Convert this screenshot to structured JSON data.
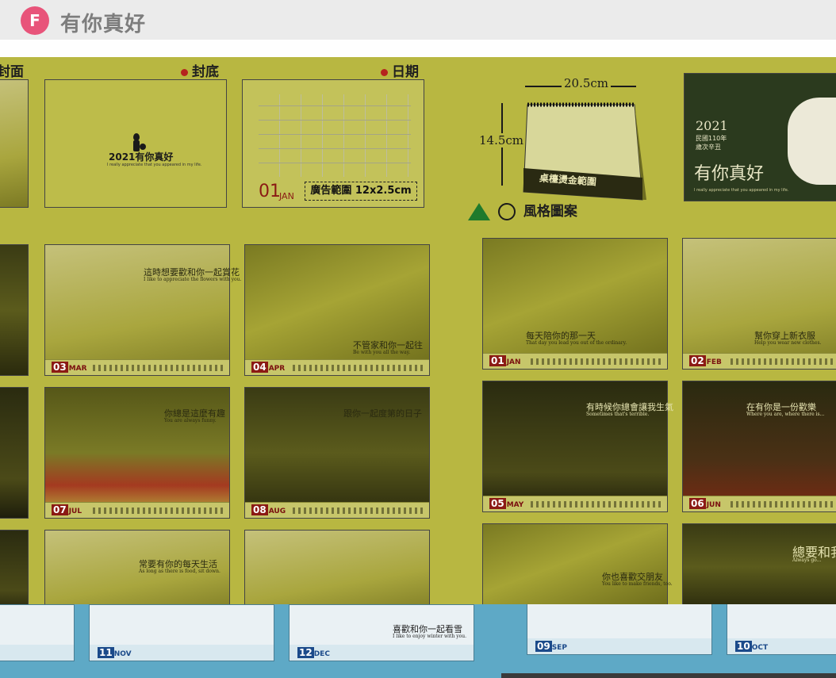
{
  "header": {
    "badge": "F",
    "title": "有你真好"
  },
  "sections": {
    "cover_front": "封面",
    "cover_back": "封底",
    "date": "日期",
    "style": "風格圖案"
  },
  "back_cover_title": "2021有你真好",
  "back_cover_sub": "I really appreciate that you appeared in my life.",
  "date_sample": {
    "month_num": "01",
    "month": "JAN",
    "ad_area": "廣告範圍 12x2.5cm"
  },
  "desk": {
    "width": "20.5cm",
    "height": "14.5cm",
    "foil": "桌檯燙金範圍"
  },
  "front_cover": {
    "year": "2021",
    "roc": "民國110年",
    "ganzhi": "歲次辛丑",
    "title": "有你真好",
    "sub": "I really appreciate that you appeared in my life."
  },
  "months_left": [
    {
      "num": "03",
      "mon": "MAR",
      "caption": "這時想要歡和你一起賞花",
      "sub": "I like to appreciate the flowers with you."
    },
    {
      "num": "04",
      "mon": "APR",
      "caption": "不管家和你一起往",
      "sub": "Be with you all the way."
    },
    {
      "num": "07",
      "mon": "JUL",
      "caption": "你總是這麼有趣",
      "sub": "You are always funny."
    },
    {
      "num": "08",
      "mon": "AUG",
      "caption": "跟你一起度第的日子",
      "sub": ""
    },
    {
      "caption": "常要有你的每天生活",
      "sub": "As long as there is food, sit down."
    }
  ],
  "months_right": [
    {
      "num": "01",
      "mon": "JAN",
      "caption": "每天陪你的那一天",
      "sub": "That day you lead you out of the ordinary."
    },
    {
      "num": "02",
      "mon": "FEB",
      "caption": "幫你穿上新衣服",
      "sub": "Help you wear new clothes."
    },
    {
      "num": "05",
      "mon": "MAY",
      "caption": "有時候你總會讓我生氣",
      "sub": "Sometimes that's terrible."
    },
    {
      "num": "06",
      "mon": "JUN",
      "caption": "在有你是一份歡樂",
      "sub": "Where you are, where there is..."
    },
    {
      "caption": "你也喜歡交朋友",
      "sub": "You like to make friends, too."
    },
    {
      "caption": "總要和我",
      "sub": "Always go..."
    }
  ],
  "bottom_cards": [
    {
      "num": "11",
      "mon": "NOV"
    },
    {
      "num": "12",
      "mon": "DEC",
      "caption": "喜歡和你一起看雪",
      "sub": "I like to enjoy winter with you."
    },
    {
      "num": "09",
      "mon": "SEP"
    },
    {
      "num": "10",
      "mon": "OCT"
    }
  ],
  "colors": {
    "canvas": "#b8b741",
    "band": "#5ea9c6",
    "accent": "#e8547a",
    "month_red": "#8b1a14"
  }
}
